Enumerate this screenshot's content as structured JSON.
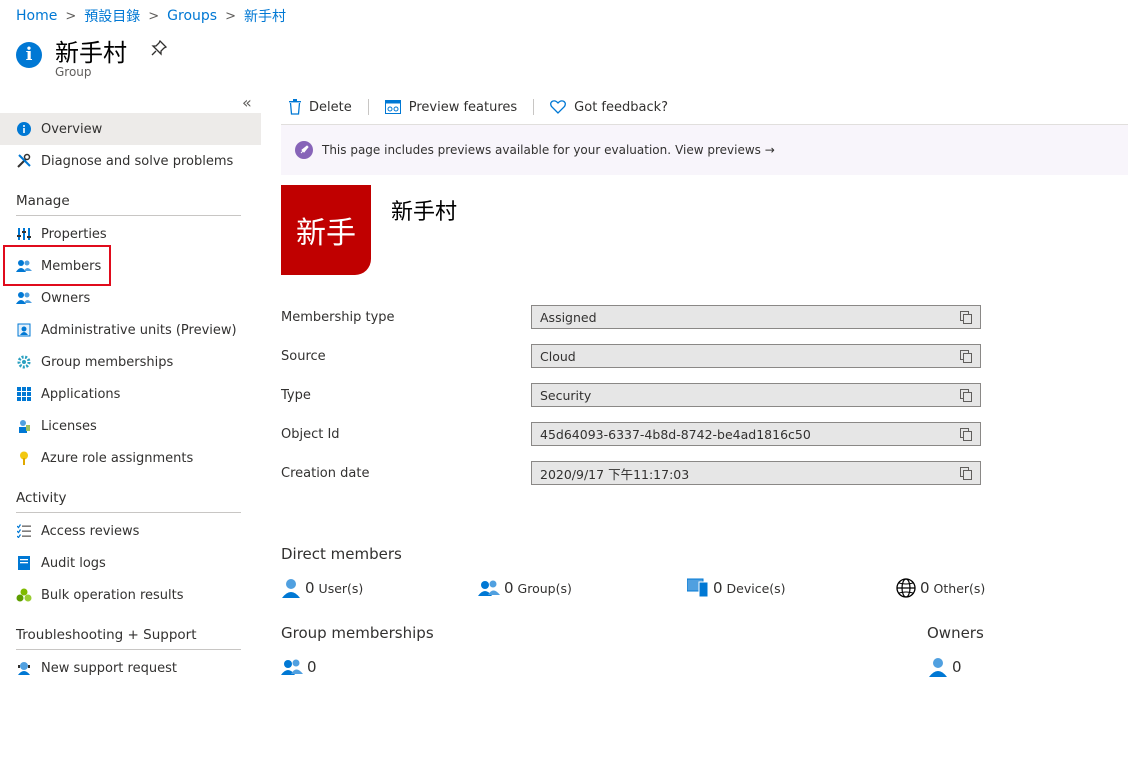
{
  "breadcrumb": [
    "Home",
    "預設目錄",
    "Groups",
    "新手村"
  ],
  "header": {
    "title": "新手村",
    "subtitle": "Group"
  },
  "sidebar": {
    "items_top": [
      "Overview",
      "Diagnose and solve problems"
    ],
    "manage_label": "Manage",
    "manage": [
      "Properties",
      "Members",
      "Owners",
      "Administrative units (Preview)",
      "Group memberships",
      "Applications",
      "Licenses",
      "Azure role assignments"
    ],
    "activity_label": "Activity",
    "activity": [
      "Access reviews",
      "Audit logs",
      "Bulk operation results"
    ],
    "support_label": "Troubleshooting + Support",
    "support": [
      "New support request"
    ]
  },
  "toolbar": {
    "delete": "Delete",
    "preview": "Preview features",
    "feedback": "Got feedback?"
  },
  "banner": {
    "text": "This page includes previews available for your evaluation.",
    "link": "View previews →"
  },
  "group": {
    "tile_text": "新手",
    "name": "新手村"
  },
  "properties": [
    {
      "label": "Membership type",
      "value": "Assigned"
    },
    {
      "label": "Source",
      "value": "Cloud"
    },
    {
      "label": "Type",
      "value": "Security"
    },
    {
      "label": "Object Id",
      "value": "45d64093-6337-4b8d-8742-be4ad1816c50"
    },
    {
      "label": "Creation date",
      "value": "2020/9/17 下午11:17:03"
    }
  ],
  "direct_members": {
    "title": "Direct members",
    "users": {
      "count": "0",
      "label": "User(s)"
    },
    "groups": {
      "count": "0",
      "label": "Group(s)"
    },
    "devices": {
      "count": "0",
      "label": "Device(s)"
    },
    "others": {
      "count": "0",
      "label": "Other(s)"
    }
  },
  "group_memberships": {
    "title": "Group memberships",
    "count": "0"
  },
  "owners": {
    "title": "Owners",
    "count": "0"
  },
  "colors": {
    "accent": "#0078d4",
    "tile": "#c00000",
    "highlight": "#e00b1c",
    "banner_bg": "#f8f5fb"
  }
}
